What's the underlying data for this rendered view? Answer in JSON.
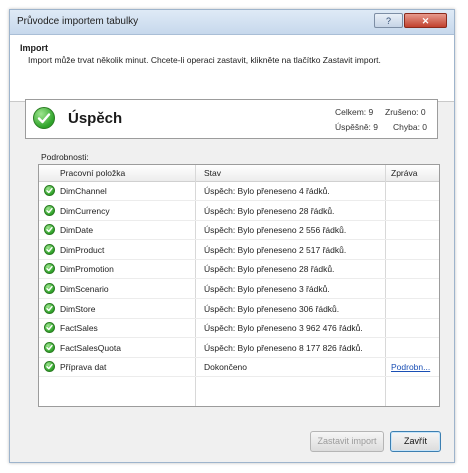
{
  "window": {
    "title": "Průvodce importem tabulky",
    "help_label": "?",
    "close_label": "✕"
  },
  "header": {
    "title": "Import",
    "description": "Import může trvat několik minut. Chcete-li operaci zastavit, klikněte na tlačítko Zastavit import."
  },
  "status": {
    "text": "Úspěch",
    "total": "Celkem: 9",
    "cancelled": "Zrušeno: 0",
    "success": "Úspěšně: 9",
    "error": "Chyba: 0"
  },
  "details_label": "Podrobnosti:",
  "grid": {
    "headers": [
      "Pracovní položka",
      "Stav",
      "Zpráva"
    ],
    "rows": [
      {
        "item": "DimChannel",
        "status": "Úspěch: Bylo přeneseno 4 řádků.",
        "message": ""
      },
      {
        "item": "DimCurrency",
        "status": "Úspěch: Bylo přeneseno 28 řádků.",
        "message": ""
      },
      {
        "item": "DimDate",
        "status": "Úspěch: Bylo přeneseno 2 556 řádků.",
        "message": ""
      },
      {
        "item": "DimProduct",
        "status": "Úspěch: Bylo přeneseno 2 517 řádků.",
        "message": ""
      },
      {
        "item": "DimPromotion",
        "status": "Úspěch: Bylo přeneseno 28 řádků.",
        "message": ""
      },
      {
        "item": "DimScenario",
        "status": "Úspěch: Bylo přeneseno 3 řádků.",
        "message": ""
      },
      {
        "item": "DimStore",
        "status": "Úspěch: Bylo přeneseno 306 řádků.",
        "message": ""
      },
      {
        "item": "FactSales",
        "status": "Úspěch: Bylo přeneseno 3 962 476 řádků.",
        "message": ""
      },
      {
        "item": "FactSalesQuota",
        "status": "Úspěch: Bylo přeneseno 8 177 826 řádků.",
        "message": ""
      },
      {
        "item": "Příprava dat",
        "status": "Dokončeno",
        "message": "Podrobn..."
      }
    ]
  },
  "buttons": {
    "stop_label": "Zastavit import",
    "close_label": "Zavřít"
  },
  "colors": {
    "success_green": "#2fa32a",
    "link_blue": "#1a4fb5",
    "title_bar": "#c7d8ec"
  },
  "icons": {
    "status": "success-check-icon",
    "row": "success-check-icon"
  }
}
